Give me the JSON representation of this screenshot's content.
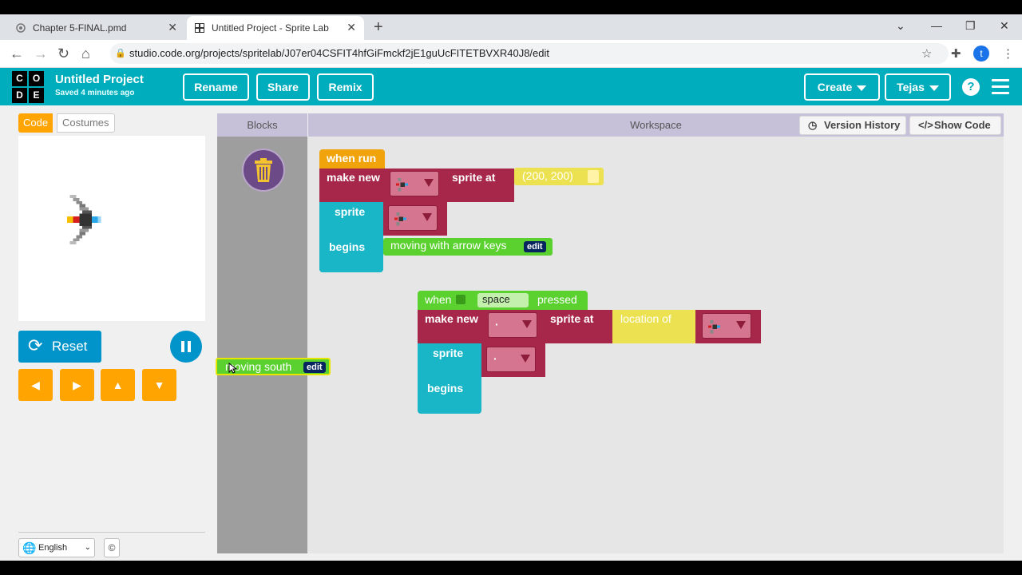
{
  "browser": {
    "tabs": [
      {
        "title": "Chapter 5-FINAL.pmd",
        "active": false
      },
      {
        "title": "Untitled Project - Sprite Lab",
        "active": true
      }
    ],
    "url": "studio.code.org/projects/spritelab/J07er04CSFIT4hfGiFmckf2jE1guUcFITETBVXR40J8/edit",
    "profile_initial": "t"
  },
  "header": {
    "logo_letters": [
      "C",
      "O",
      "D",
      "E"
    ],
    "project_title": "Untitled Project",
    "saved_status": "Saved 4 minutes ago",
    "buttons": {
      "rename": "Rename",
      "share": "Share",
      "remix": "Remix",
      "create": "Create",
      "user": "Tejas"
    },
    "help": "?"
  },
  "left_panel": {
    "tabs": {
      "code": "Code",
      "costumes": "Costumes"
    },
    "reset_label": "Reset",
    "language": "English",
    "copyright": "©"
  },
  "workspace": {
    "blocks_header": "Blocks",
    "workspace_header": "Workspace",
    "version_history": "Version History",
    "show_code": "Show Code",
    "toolbox_block": {
      "label": "moving south",
      "edit": "edit"
    },
    "script1": {
      "hat": "when run",
      "make_new": "make new",
      "sprite_at": "sprite at",
      "location": "(200, 200)",
      "sprite": "sprite",
      "begins": "begins",
      "behavior": "moving with arrow keys",
      "edit": "edit"
    },
    "script2": {
      "when": "when",
      "key": "space",
      "pressed": "pressed",
      "make_new": "make new",
      "sprite_at": "sprite at",
      "location_of": "location of",
      "sprite": "sprite",
      "begins": "begins",
      "dot": "·"
    }
  },
  "colors": {
    "codeorg_teal": "#00adbc",
    "event_orange": "#f0a30a",
    "sprite_maroon": "#a6274a",
    "behavior_teal": "#19b6c7",
    "behavior_green": "#5bd130",
    "location_yellow": "#ece151"
  }
}
